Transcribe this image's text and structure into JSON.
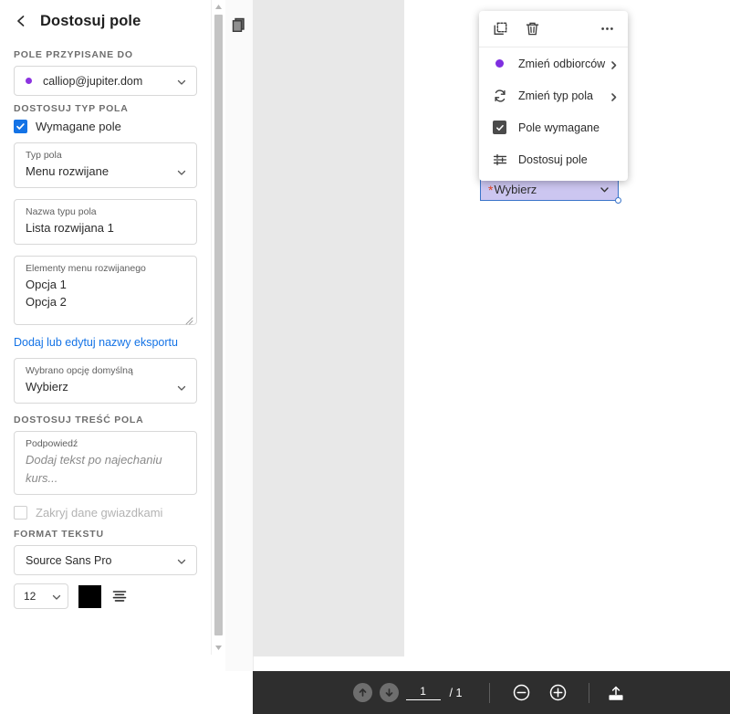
{
  "panel": {
    "title": "Dostosuj pole",
    "back_icon": "chevron-left-icon",
    "sections": {
      "assigned_to": "POLE PRZYPISANE DO",
      "field_type": "DOSTOSUJ TYP POLA",
      "field_content": "DOSTOSUJ TREŚĆ POLA",
      "text_format": "FORMAT TEKSTU"
    },
    "recipient": {
      "value": "calliop@jupiter.dom",
      "dot_color": "#8c33e0",
      "chevron": "chevron-down-icon"
    },
    "required_checkbox": {
      "label": "Wymagane pole",
      "checked": true,
      "color": "#1473e6"
    },
    "field_type_field": {
      "label": "Typ pola",
      "value": "Menu rozwijane"
    },
    "field_name_field": {
      "label": "Nazwa typu pola",
      "value": "Lista rozwijana 1"
    },
    "dropdown_items_field": {
      "label": "Elementy menu rozwijanego",
      "option_1": "Opcja 1",
      "option_2": "Opcja 2"
    },
    "export_link": "Dodaj lub edytuj nazwy eksportu",
    "default_option_field": {
      "label": "Wybrano opcję domyślną",
      "value": "Wybierz"
    },
    "tooltip_field": {
      "label": "Podpowiedź",
      "placeholder": "Dodaj tekst po najechaniu kurs..."
    },
    "mask_checkbox": {
      "label": "Zakryj dane gwiazdkami",
      "checked": false,
      "disabled": true
    },
    "font_family": "Source Sans Pro",
    "font_size": "12",
    "font_color": "#000000",
    "align_icon": "text-align-icon"
  },
  "context_menu": {
    "toolbar": {
      "duplicate_icon": "duplicate-field-icon",
      "delete_icon": "trash-icon",
      "more_icon": "more-options-icon"
    },
    "items": [
      {
        "label": "Zmień odbiorców",
        "icon": "recipient-dot-icon",
        "has_submenu": true
      },
      {
        "label": "Zmień typ pola",
        "icon": "refresh-icon",
        "has_submenu": true
      },
      {
        "label": "Pole wymagane",
        "icon": "checkbox-checked-icon",
        "has_submenu": false
      },
      {
        "label": "Dostosuj pole",
        "icon": "sliders-icon",
        "has_submenu": false
      }
    ]
  },
  "form_field": {
    "required_marker": "*",
    "value": "Wybierz",
    "chevron": "chevron-down-icon",
    "fill_color": "#ccc6f0",
    "border_color": "#3a74c9"
  },
  "document": {
    "thumbnail_icon": "page-thumbnail-icon"
  },
  "bottom_toolbar": {
    "prev_page_icon": "arrow-up-icon",
    "next_page_icon": "arrow-down-icon",
    "current_page": "1",
    "total_pages": "/ 1",
    "zoom_out_icon": "zoom-out-icon",
    "zoom_in_icon": "zoom-in-icon",
    "export_icon": "upload-page-icon"
  }
}
